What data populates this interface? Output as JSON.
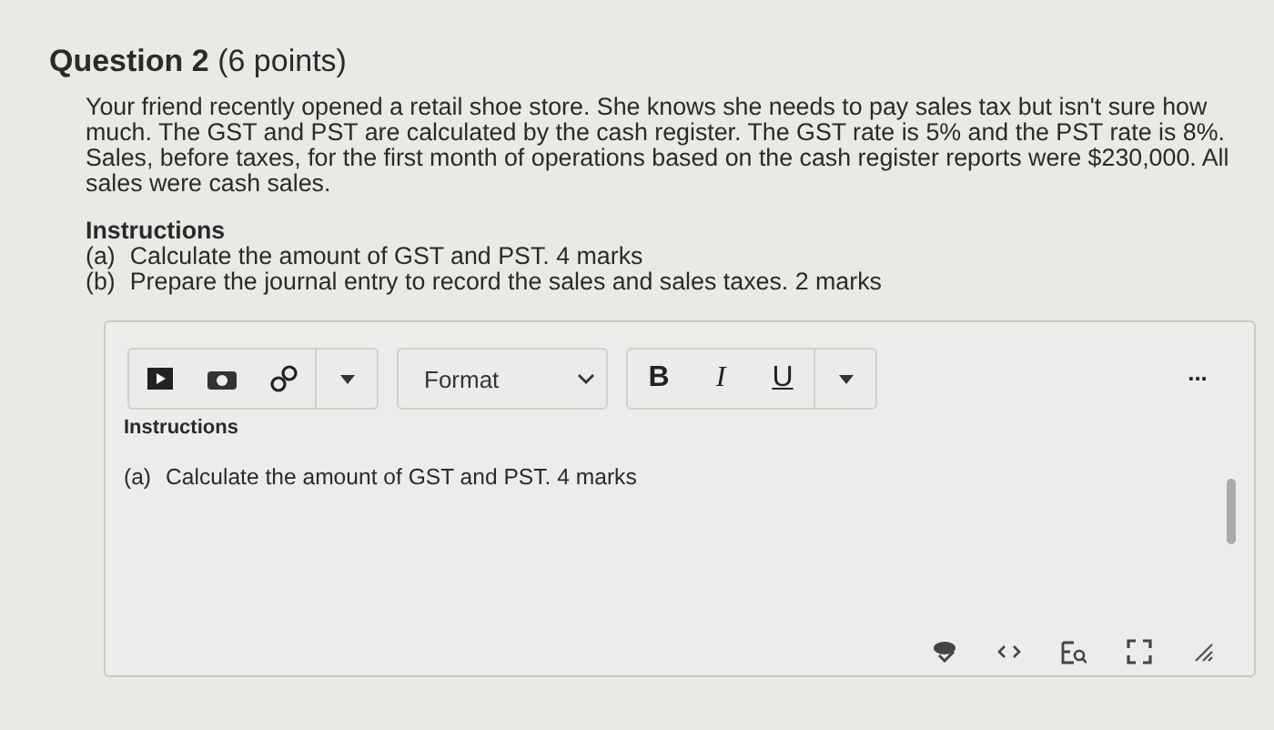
{
  "question": {
    "title": "Question 2",
    "points": "(6 points)"
  },
  "prompt": "Your friend recently opened a retail shoe store. She knows she needs to pay sales tax but isn't sure how much. The GST and PST are calculated by the cash register. The GST rate is 5% and the PST rate is 8%. Sales, before taxes, for the first month of operations based on the cash register reports were $230,000. All sales were cash sales.",
  "instructions": {
    "heading": "Instructions",
    "items": [
      {
        "marker": "(a)",
        "text": "Calculate the amount of GST and PST. 4 marks"
      },
      {
        "marker": "(b)",
        "text": "Prepare the journal entry to record the sales and sales taxes. 2 marks"
      }
    ]
  },
  "editor": {
    "format_select": "Format",
    "toolbar_letters": [
      "B",
      "I",
      "U"
    ],
    "more": "...",
    "content_heading": "Instructions",
    "content_lines": [
      {
        "marker": "(a)",
        "text": "Calculate the amount of GST and PST. 4 marks"
      }
    ]
  }
}
